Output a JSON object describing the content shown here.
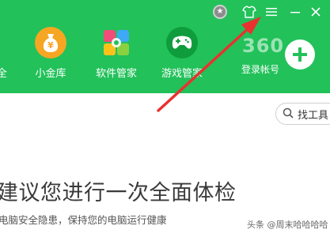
{
  "titlebar": {
    "medal_icon": "medal-icon",
    "skin_icon": "tshirt-icon",
    "menu_icon": "hamburger-menu-icon",
    "minimize_icon": "minimize-icon",
    "close_icon": "close-icon"
  },
  "nav": {
    "cut_label": "全",
    "items": [
      {
        "label": "小金库",
        "icon": "gold-coin-bag-icon"
      },
      {
        "label": "软件管家",
        "icon": "software-manager-icon"
      },
      {
        "label": "游戏管家",
        "icon": "gamepad-icon"
      }
    ]
  },
  "account": {
    "brand": "360",
    "login_label": "登录帐号",
    "add_icon": "plus-icon"
  },
  "search": {
    "label": "找工具",
    "icon": "search-icon"
  },
  "main": {
    "headline": "建议您进行一次全面体检",
    "subline": "电脑安全隐患，保持您的电脑运行健康"
  },
  "watermark": "头条 @周末哈哈哈哈",
  "colors": {
    "banner_green": "#22c15a",
    "arrow_red": "#e8322f",
    "gold": "#f6a623",
    "game_green": "#0f9c3c"
  }
}
